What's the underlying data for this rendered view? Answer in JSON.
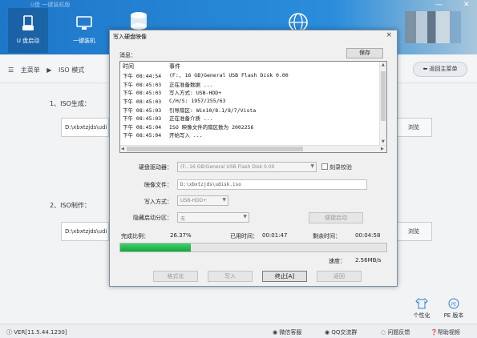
{
  "app": {
    "title": "U盘  一键装机版",
    "nav": [
      {
        "label": "U 盘启动",
        "active": true
      },
      {
        "label": "一键装机",
        "active": false
      }
    ]
  },
  "breadcrumb": {
    "root": "主菜单",
    "sep": "▶",
    "current": "ISO 模式"
  },
  "back_button": "返回主菜单",
  "main": {
    "section1": "1、ISO生成：",
    "section2": "2、ISO制作：",
    "path1": "D:\\xbxtzjds\\udi",
    "path2": "D:\\xbxtzjds\\udi",
    "browse_label": "浏览",
    "personalize": "个性化",
    "pe_version": "PE 版本"
  },
  "statusbar": {
    "version": "VER[11.5.44.1230]",
    "wechat": "微信客服",
    "qq": "QQ交流群",
    "feedback": "问题反馈",
    "help": "帮助视频"
  },
  "dialog": {
    "title": "写入硬盘映像",
    "close": "×",
    "message_label": "消息：",
    "save_label": "保存",
    "log_headers": [
      "时间",
      "事件"
    ],
    "log": [
      {
        "time": "下午 08:44:54",
        "event": "(F:, 16 GB)General USB Flash Disk  0.00"
      },
      {
        "time": "下午 08:45:03",
        "event": "正在准备数据 ..."
      },
      {
        "time": "下午 08:45:03",
        "event": "写入方式: USB-HDD+"
      },
      {
        "time": "下午 08:45:03",
        "event": "C/H/S: 1957/255/63"
      },
      {
        "time": "下午 08:45:03",
        "event": "引导扇区: Win10/8.1/8/7/Vista"
      },
      {
        "time": "下午 08:45:03",
        "event": "正在准备介质 ..."
      },
      {
        "time": "下午 08:45:04",
        "event": "ISO 映像文件的扇区数为 2002256"
      },
      {
        "time": "下午 08:45:04",
        "event": "开始写入 ..."
      }
    ],
    "drive_label": "硬盘驱动器：",
    "drive_value": "(F:, 16 GB)General USB Flash Disk  0.00",
    "verify_label": "刻录校验",
    "image_label": "映像文件：",
    "image_value": "D:\\xbxtzjds\\udisk.iso",
    "write_mode_label": "写入方式：",
    "write_mode_value": "USB-HDD+",
    "hidden_part_label": "隐藏启动分区：",
    "hidden_part_value": "无",
    "quick_boot_label": "便捷启动",
    "done_label": "完成比例：",
    "done_value": "26.37%",
    "elapsed_label": "已用时间：",
    "elapsed_value": "00:01:47",
    "remain_label": "剩余时间：",
    "remain_value": "00:04:58",
    "progress": 0.2637,
    "speed_label": "速度：",
    "speed_value": "2.56MB/s",
    "buttons": {
      "format": "格式化",
      "write": "写入",
      "stop": "终止[A]",
      "back": "返回"
    }
  },
  "colors": {
    "header": "#1f77c9",
    "progress": "#17a63f"
  }
}
